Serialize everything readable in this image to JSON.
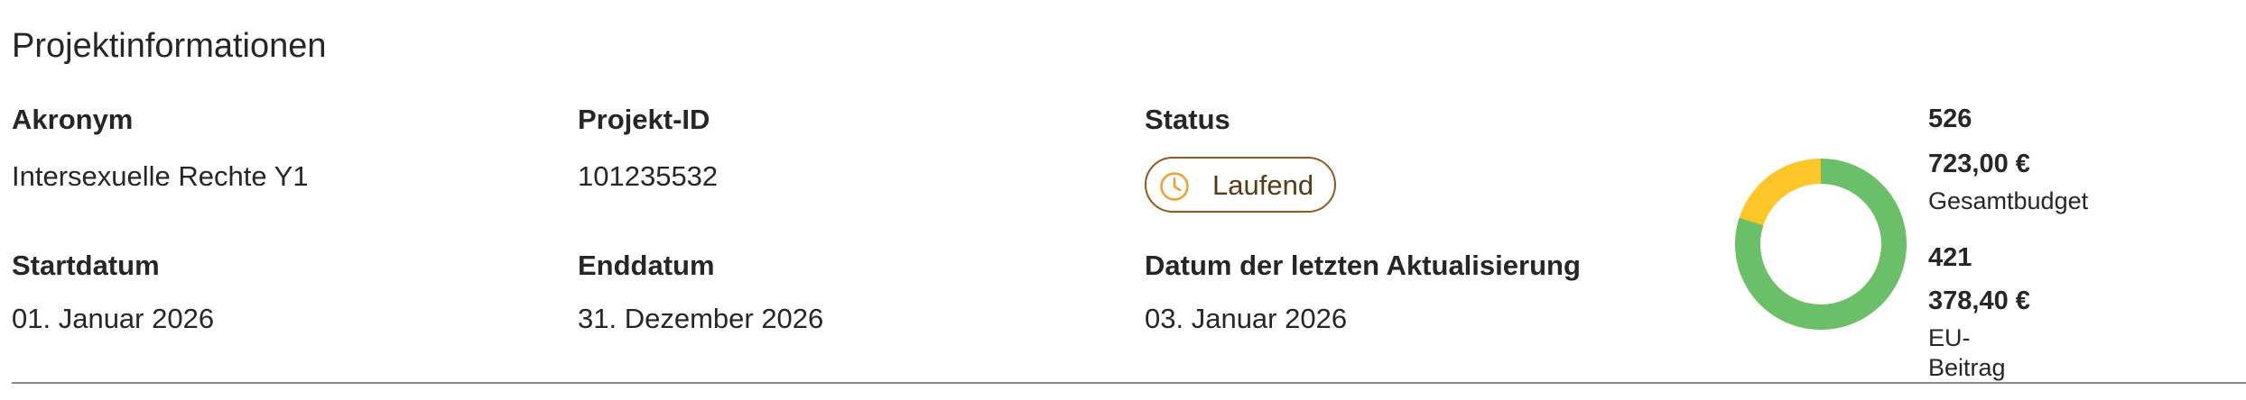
{
  "section": {
    "title": "Projektinformationen"
  },
  "fields": {
    "acronym": {
      "label": "Akronym",
      "value": "Intersexuelle Rechte Y1"
    },
    "project_id": {
      "label": "Projekt-ID",
      "value": "101235532"
    },
    "status": {
      "label": "Status",
      "value": "Laufend",
      "icon": "clock-icon"
    },
    "start_date": {
      "label": "Startdatum",
      "value": "01. Januar 2026"
    },
    "end_date": {
      "label": "Enddatum",
      "value": "31. Dezember 2026"
    },
    "last_update": {
      "label": "Datum der letzten Aktualisierung",
      "value": "03. Januar 2026"
    }
  },
  "budget": {
    "total": {
      "line1": "526",
      "line2": "723,00 €",
      "label": "Gesamtbudget",
      "amount": 526723.0,
      "color": "#ffc629"
    },
    "eu_contribution": {
      "line1": "421",
      "line2": "378,40 €",
      "label_line1": "EU-",
      "label_line2": "Beitrag",
      "amount": 421378.4,
      "color": "#6abf69"
    }
  },
  "colors": {
    "text": "#262626",
    "badge_border": "#8a5a20",
    "badge_icon": "#f0a030",
    "divider": "#8a8a8a"
  }
}
